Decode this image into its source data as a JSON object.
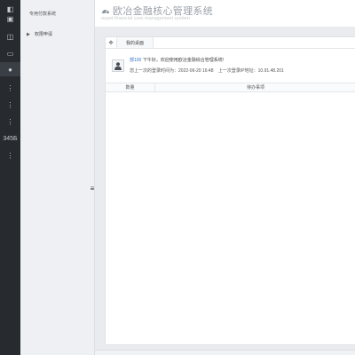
{
  "rail": {
    "items": [
      {
        "icon": "dashboard-icon",
        "glyph": "◧"
      },
      {
        "icon": "grid-icon",
        "glyph": "▣"
      },
      {
        "icon": "layers-icon",
        "glyph": "◫"
      },
      {
        "icon": "monitor-icon",
        "glyph": "▭"
      },
      {
        "icon": "user-icon",
        "glyph": "●"
      },
      {
        "icon": "more-icon",
        "glyph": "⋮"
      },
      {
        "icon": "more-icon-2",
        "glyph": "⋮"
      },
      {
        "icon": "more-icon-3",
        "glyph": "⋮"
      },
      {
        "icon": "more-icon-4",
        "glyph": "⋮"
      }
    ],
    "counter_text": "345Б"
  },
  "sidebar": {
    "header": "专用付款系统",
    "item_label": "权限申请"
  },
  "header": {
    "title": "欧冶金融核心管理系统",
    "subtitle": "ouyet financial core management system"
  },
  "tabs": [
    {
      "label": "我的桌面"
    }
  ],
  "welcome": {
    "user": "部100",
    "greeting": " 下午好，欢迎使用欧冶金融综合管理系统!",
    "last_login_label": "您上一次的登录时间为：",
    "last_login_time": "2022-06-20 16:48",
    "last_ip_label": "上一次登录IP地址：",
    "last_ip": "10.91.48.201"
  },
  "table": {
    "columns": [
      "数量",
      "待办事项"
    ]
  },
  "colors": {
    "rail_bg": "#272b2f",
    "accent_link": "#3576c4",
    "title_gray": "#9aa1a8"
  }
}
